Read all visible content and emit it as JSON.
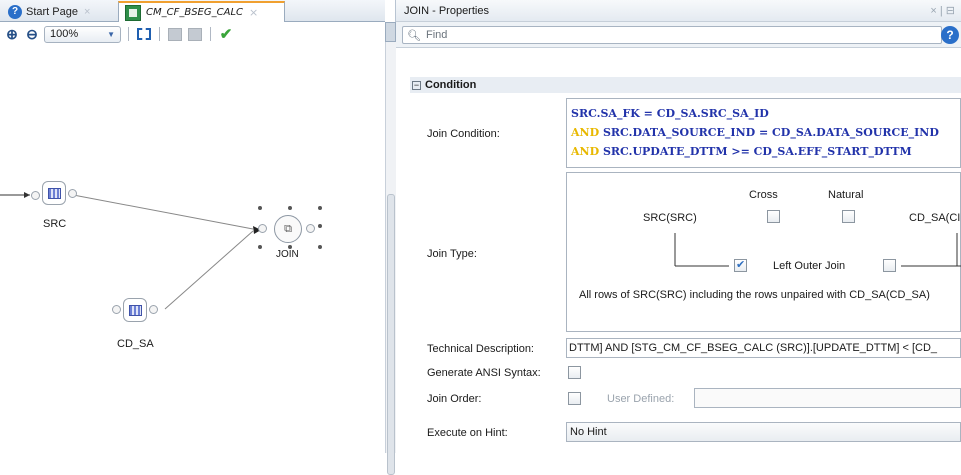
{
  "editor": {
    "tabs": [
      {
        "label": "Start Page",
        "icon": "help-icon"
      },
      {
        "label": "CM_CF_BSEG_CALC",
        "icon": "mapping-icon"
      }
    ],
    "toolbar": {
      "zoom_value": "100%"
    },
    "diagram": {
      "nodes": [
        {
          "label": "SRC",
          "icon": "datastore-icon"
        },
        {
          "label": "CD_SA",
          "icon": "datastore-icon"
        },
        {
          "label": "JOIN",
          "icon": "join-icon"
        }
      ]
    }
  },
  "properties": {
    "title": "JOIN - Properties",
    "find_placeholder": "Find",
    "section": "Condition",
    "join_condition": {
      "label": "Join Condition:",
      "lines": [
        {
          "prefix": "",
          "text": "SRC.SA_FK = CD_SA.SRC_SA_ID"
        },
        {
          "prefix": "AND",
          "text": " SRC.DATA_SOURCE_IND = CD_SA.DATA_SOURCE_IND"
        },
        {
          "prefix": "AND",
          "text": " SRC.UPDATE_DTTM >= CD_SA.EFF_START_DTTM"
        }
      ]
    },
    "join_type": {
      "label": "Join Type:",
      "cross_label": "Cross",
      "natural_label": "Natural",
      "left_table": "SRC(SRC)",
      "right_table": "CD_SA(CI",
      "left_outer_label": "Left Outer Join",
      "left_outer_checked": true,
      "right_outer_checked": false,
      "description": "All rows of SRC(SRC) including the rows unpaired with CD_SA(CD_SA)"
    },
    "technical_description": {
      "label": "Technical Description:",
      "value": "DTTM]  AND [STG_CM_CF_BSEG_CALC (SRC)].[UPDATE_DTTM] < [CD_"
    },
    "ansi": {
      "label": "Generate ANSI Syntax:"
    },
    "join_order": {
      "label": "Join Order:",
      "user_defined_label": "User Defined:"
    },
    "execute_hint": {
      "label": "Execute on Hint:",
      "value": "No Hint"
    }
  },
  "colors": {
    "keyword": "#e8b800",
    "condition_text": "#2233aa",
    "accent_tab": "#f0a030"
  }
}
